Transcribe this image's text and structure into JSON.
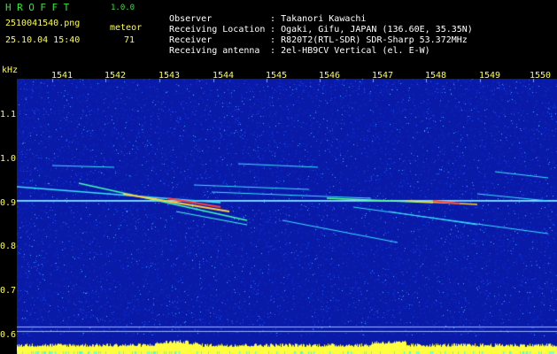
{
  "header": {
    "app_name": "HROFFT",
    "version": "1.0.0",
    "filename": "2510041540.png",
    "datetime": "25.10.04 15:40",
    "detection_type": "meteor",
    "count": "71"
  },
  "info": [
    {
      "label": "Observer",
      "value": ": Takanori Kawachi"
    },
    {
      "label": "Receiving Location",
      "value": ": Ogaki, Gifu, JAPAN (136.60E, 35.35N)"
    },
    {
      "label": "Receiver",
      "value": ": R820T2(RTL-SDR) SDR-Sharp 53.372MHz"
    },
    {
      "label": "Receiving antenna",
      "value": ": 2el-HB9CV Vertical (el. E-W)"
    }
  ],
  "axes": {
    "y_unit": "kHz",
    "y_ticks": [
      "1.1",
      "1.0",
      "0.9",
      "0.8",
      "0.7",
      "0.6"
    ],
    "x_ticks": [
      "1541",
      "1542",
      "1543",
      "1544",
      "1545",
      "1546",
      "1547",
      "1548",
      "1549",
      "1550"
    ]
  },
  "colors": {
    "background": "#000000",
    "spectrum_bg": "#0a1aa8",
    "tick_text": "#ffff40",
    "title_green": "#32e632"
  }
}
